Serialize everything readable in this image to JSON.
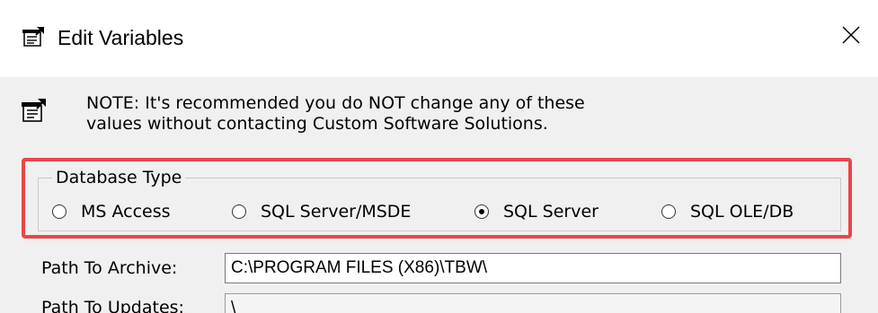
{
  "window": {
    "title": "Edit Variables",
    "icon": "properties-icon",
    "close_glyph": "✕"
  },
  "note": {
    "icon": "properties-icon",
    "text": "NOTE: It's recommended you do NOT change any of these\nvalues without contacting Custom Software Solutions."
  },
  "database_type": {
    "legend": "Database Type",
    "selected": "SQL Server",
    "options": [
      {
        "label": "MS Access",
        "checked": false
      },
      {
        "label": "SQL Server/MSDE",
        "checked": false
      },
      {
        "label": "SQL Server",
        "checked": true
      },
      {
        "label": "SQL OLE/DB",
        "checked": false
      }
    ]
  },
  "fields": {
    "archive_label": "Path To Archive:",
    "archive_value": "C:\\PROGRAM FILES (X86)\\TBW\\",
    "updates_label": "Path To Updates:",
    "updates_value": "\\"
  },
  "colors": {
    "highlight": "#e8464a",
    "client_bg": "#f0f0f0"
  }
}
